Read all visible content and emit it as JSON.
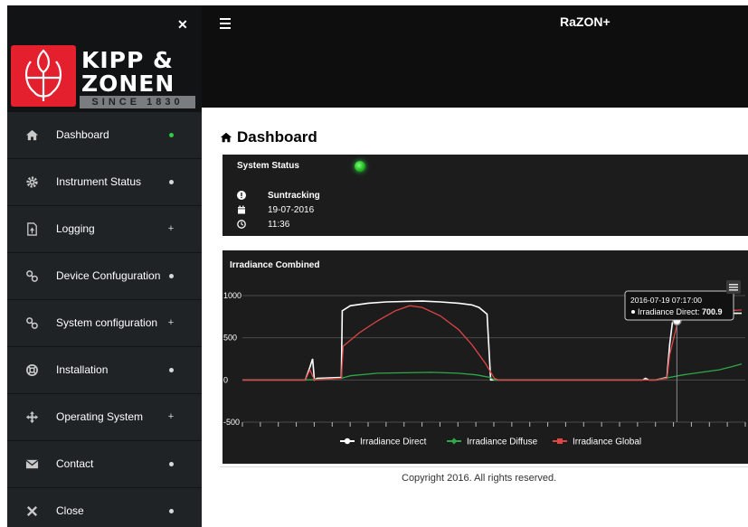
{
  "header": {
    "app_title": "RaZON+"
  },
  "logo": {
    "line1": "KIPP &",
    "line2": "ZONEN",
    "since": "SINCE 1830"
  },
  "sidebar": {
    "items": [
      {
        "label": "Dashboard",
        "icon": "home-icon",
        "indicator": "dot-green"
      },
      {
        "label": "Instrument Status",
        "icon": "gear-icon",
        "indicator": "dot"
      },
      {
        "label": "Logging",
        "icon": "file-icon",
        "indicator": "plus"
      },
      {
        "label": "Device Confuguration",
        "icon": "link-icon",
        "indicator": "dot"
      },
      {
        "label": "System configuration",
        "icon": "link-icon",
        "indicator": "plus"
      },
      {
        "label": "Installation",
        "icon": "lifebuoy-icon",
        "indicator": "dot"
      },
      {
        "label": "Operating System",
        "icon": "move-icon",
        "indicator": "plus"
      },
      {
        "label": "Contact",
        "icon": "envelope-icon",
        "indicator": "dot"
      },
      {
        "label": "Close",
        "icon": "close-icon",
        "indicator": "dot"
      }
    ]
  },
  "main": {
    "page_title": "Dashboard",
    "status": {
      "title": "System Status",
      "mode": "Suntracking",
      "date": "19-07-2016",
      "time": "11:36"
    },
    "chart_title": "Irradiance Combined",
    "copyright": "Copyright 2016. All rights reserved."
  },
  "colors": {
    "accent_green": "#2ecc40",
    "direct": "#ffffff",
    "diffuse": "#2ea84a",
    "global": "#e04545",
    "panel": "#1c1c1c"
  },
  "chart_data": {
    "type": "line",
    "title": "Irradiance Combined",
    "xlabel": "",
    "ylabel": "",
    "ylim": [
      -500,
      1000
    ],
    "yticks": [
      -500,
      0,
      500,
      1000
    ],
    "x_range_hours": [
      0,
      48
    ],
    "grid": true,
    "legend": "bottom",
    "series": [
      {
        "name": "Irradiance Direct",
        "color": "#ffffff",
        "marker": "circle",
        "points": [
          [
            0,
            0
          ],
          [
            7.0,
            0
          ],
          [
            7.5,
            150
          ],
          [
            7.8,
            250
          ],
          [
            8.0,
            0
          ],
          [
            8.3,
            20
          ],
          [
            11.0,
            30
          ],
          [
            11.1,
            820
          ],
          [
            12,
            880
          ],
          [
            14,
            910
          ],
          [
            16,
            925
          ],
          [
            18,
            930
          ],
          [
            20,
            935
          ],
          [
            22,
            925
          ],
          [
            24,
            910
          ],
          [
            25.5,
            890
          ],
          [
            26.3,
            860
          ],
          [
            27.2,
            780
          ],
          [
            27.6,
            0
          ],
          [
            28,
            0
          ],
          [
            44.5,
            0
          ],
          [
            44.8,
            20
          ],
          [
            45.2,
            0
          ],
          [
            46,
            0
          ],
          [
            47.2,
            30
          ],
          [
            47.5,
            420
          ],
          [
            47.8,
            680
          ],
          [
            48.3,
            700.9
          ],
          [
            50,
            760
          ],
          [
            52,
            780
          ],
          [
            54,
            790
          ],
          [
            55.5,
            790
          ]
        ]
      },
      {
        "name": "Irradiance Diffuse",
        "color": "#2ea84a",
        "marker": "diamond",
        "points": [
          [
            0,
            0
          ],
          [
            7.0,
            0
          ],
          [
            11,
            20
          ],
          [
            12,
            50
          ],
          [
            15,
            80
          ],
          [
            18,
            85
          ],
          [
            21,
            90
          ],
          [
            24,
            80
          ],
          [
            26,
            60
          ],
          [
            27.5,
            30
          ],
          [
            28,
            0
          ],
          [
            46,
            0
          ],
          [
            47.5,
            30
          ],
          [
            49,
            60
          ],
          [
            51,
            90
          ],
          [
            53,
            120
          ],
          [
            54.5,
            160
          ],
          [
            55.5,
            190
          ]
        ]
      },
      {
        "name": "Irradiance Global",
        "color": "#e04545",
        "marker": "square",
        "points": [
          [
            0,
            0
          ],
          [
            7.0,
            0
          ],
          [
            7.5,
            120
          ],
          [
            8,
            0
          ],
          [
            11,
            20
          ],
          [
            11.2,
            400
          ],
          [
            13,
            560
          ],
          [
            15,
            700
          ],
          [
            17,
            820
          ],
          [
            18.6,
            880
          ],
          [
            20,
            860
          ],
          [
            22,
            760
          ],
          [
            24,
            600
          ],
          [
            25.5,
            420
          ],
          [
            27,
            200
          ],
          [
            28,
            20
          ],
          [
            28.5,
            0
          ],
          [
            46,
            0
          ],
          [
            47.2,
            20
          ],
          [
            47.5,
            300
          ],
          [
            48,
            520
          ],
          [
            48.4,
            690
          ],
          [
            50,
            760
          ],
          [
            52,
            800
          ],
          [
            54,
            820
          ],
          [
            55.5,
            830
          ]
        ]
      }
    ],
    "tooltip": {
      "title": "2016-07-19 07:17:00",
      "series": "Irradiance Direct",
      "value": "700.9",
      "at_x": 48.3
    }
  }
}
